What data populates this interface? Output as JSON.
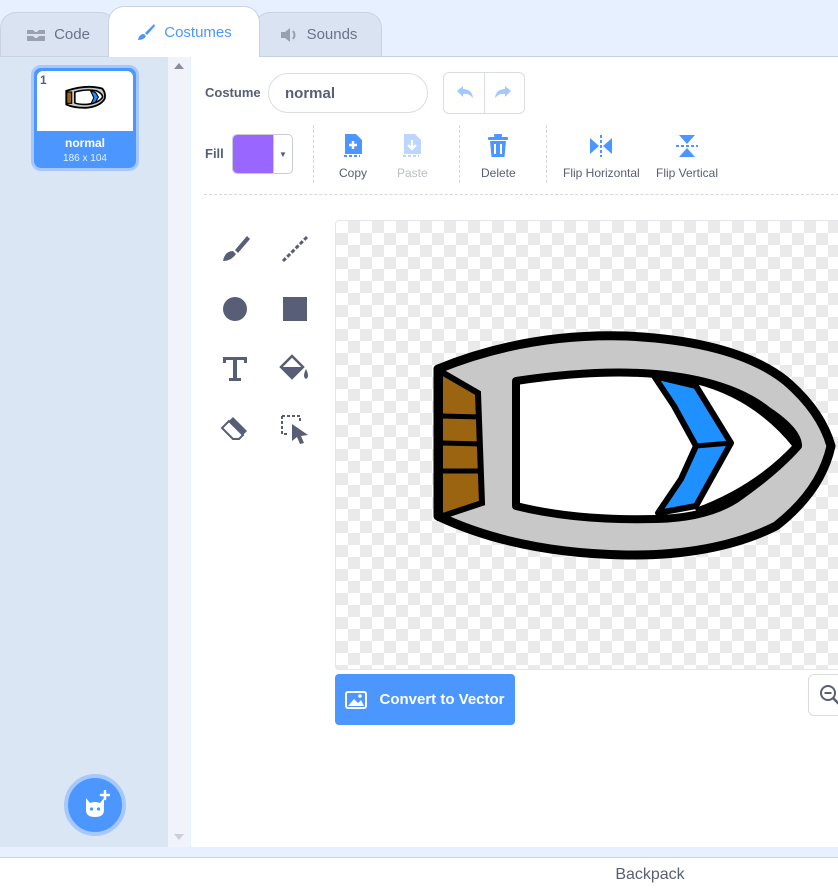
{
  "tabs": [
    {
      "label": "Code",
      "icon": "code-icon"
    },
    {
      "label": "Costumes",
      "icon": "paintbrush-icon",
      "active": true
    },
    {
      "label": "Sounds",
      "icon": "speaker-icon"
    }
  ],
  "costume_list": {
    "items": [
      {
        "number": "1",
        "name": "normal",
        "size": "186 x 104",
        "selected": true
      }
    ]
  },
  "editor": {
    "costume_label": "Costume",
    "costume_name": "normal",
    "fill_label": "Fill",
    "fill_color": "#9966ff",
    "actions": {
      "copy": "Copy",
      "paste": "Paste",
      "delete": "Delete",
      "flip_horizontal": "Flip Horizontal",
      "flip_vertical": "Flip Vertical"
    },
    "convert_button": "Convert to Vector"
  },
  "backpack_label": "Backpack",
  "colors": {
    "accent": "#4c97ff",
    "text": "#575e75",
    "boat_blue": "#1e90ff",
    "boat_brown": "#9b6410",
    "boat_gray": "#c8c8c8"
  }
}
